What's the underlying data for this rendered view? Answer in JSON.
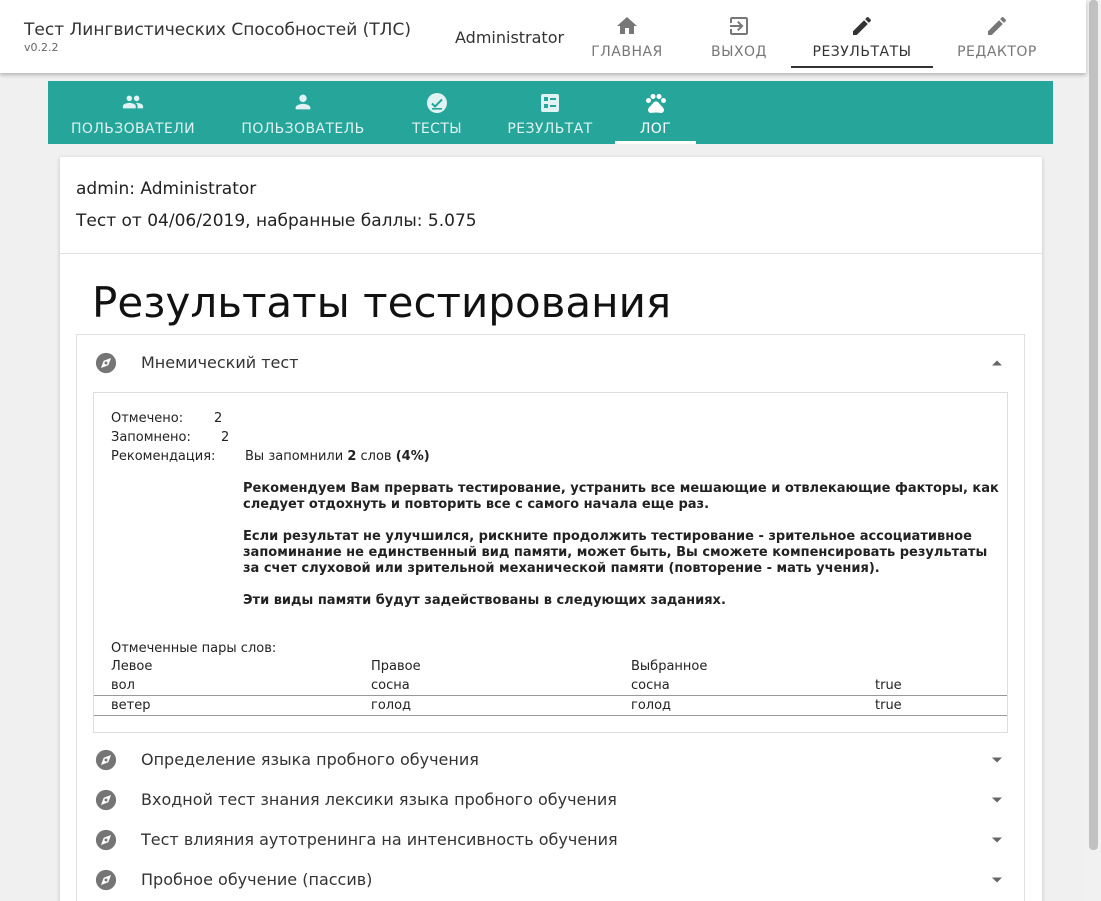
{
  "app": {
    "title": "Тест Лингвистических Способностей (ТЛС)",
    "version": "v0.2.2",
    "user": "Administrator"
  },
  "nav": [
    {
      "label": "ГЛАВНАЯ",
      "icon": "home-icon"
    },
    {
      "label": "ВЫХОД",
      "icon": "logout-icon"
    },
    {
      "label": "РЕЗУЛЬТАТЫ",
      "icon": "pencil-icon",
      "active": true
    },
    {
      "label": "РЕДАКТОР",
      "icon": "pencil-icon"
    }
  ],
  "tabs": [
    {
      "label": "ПОЛЬЗОВАТЕЛИ",
      "icon": "people-icon"
    },
    {
      "label": "ПОЛЬЗОВАТЕЛЬ",
      "icon": "person-icon"
    },
    {
      "label": "ТЕСТЫ",
      "icon": "check-circle-icon"
    },
    {
      "label": "РЕЗУЛЬТАТ",
      "icon": "list-alt-icon"
    },
    {
      "label": "ЛОГ",
      "icon": "paw-icon",
      "active": true
    }
  ],
  "colors": {
    "accent": "#26a69a",
    "icon_gray": "#757575"
  },
  "card": {
    "user_line": "admin: Administrator",
    "test_line": "Тест от 04/06/2019, набранные баллы: 5.075",
    "page_title": "Результаты тестирования"
  },
  "sections": [
    {
      "label": "Мнемический тест",
      "expanded": true
    },
    {
      "label": "Определение языка пробного обучения"
    },
    {
      "label": "Входной тест знания лексики языка пробного обучения"
    },
    {
      "label": "Тест влияния аутотренинга на интенсивность обучения"
    },
    {
      "label": "Пробное обучение (пассив)"
    }
  ],
  "mnemonic": {
    "marked_label": "Отмечено:",
    "marked_value": "2",
    "remembered_label": "Запомнено:",
    "remembered_value": "2",
    "recommendation_label": "Рекомендация:",
    "rec_prefix": "Вы запомнили",
    "rec_count": "2",
    "rec_words": "слов",
    "rec_percent": "(4%)",
    "rec_para1": "Рекомендуем Вам прервать тестирование, устранить все мешающие и отвлекающие факторы, как следует отдохнуть и повторить все с самого начала еще раз.",
    "rec_para2": "Если результат не улучшился, рискните продолжить тестирование - зрительное ассоциативное запоминание не единственный вид памяти, может быть, Вы сможете компенсировать результаты за счет слуховой или зрительной механической памяти (повторение - мать учения).",
    "rec_para3": "Эти виды памяти будут задействованы в следующих заданиях.",
    "pairs_title": "Отмеченные пары слов:",
    "columns": [
      "Левое",
      "Правое",
      "Выбранное"
    ],
    "rows": [
      [
        "вол",
        "сосна",
        "сосна",
        "true"
      ],
      [
        "ветер",
        "голод",
        "голод",
        "true"
      ]
    ]
  }
}
